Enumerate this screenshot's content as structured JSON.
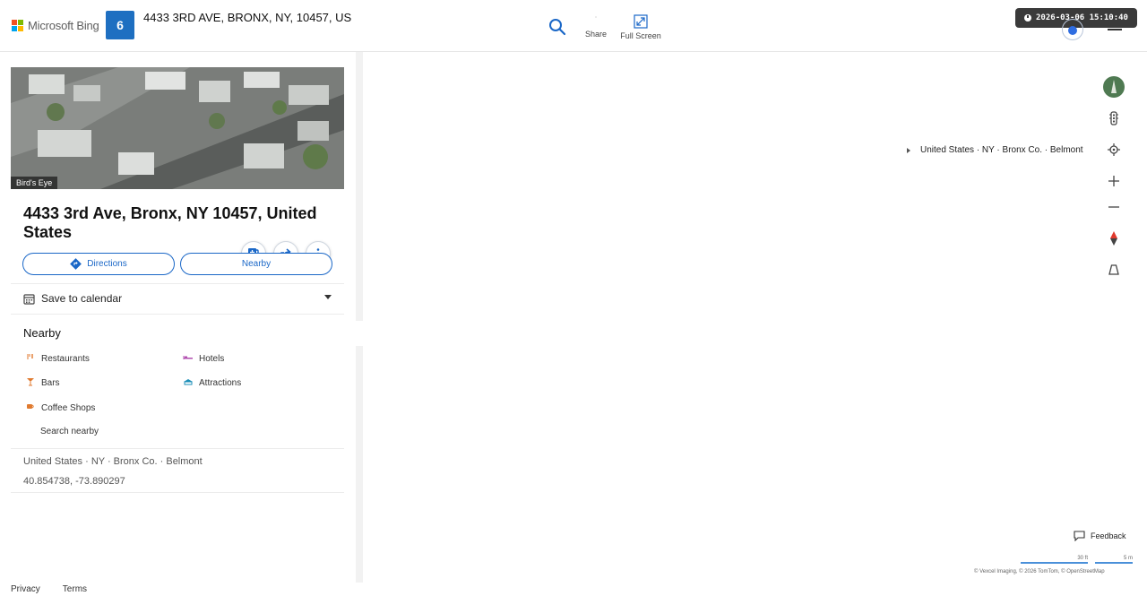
{
  "header": {
    "logo_text": "Microsoft Bing",
    "brand_colors": [
      "#f25022",
      "#7fba00",
      "#00a4ef",
      "#ffb900"
    ],
    "badge": "6",
    "search_query": "4433 3RD AVE, BRONX, NY, 10457, US",
    "share_label": "Share",
    "fullscreen_label": "Full Screen",
    "timestamp": "2026-03-06 15:10:40"
  },
  "card": {
    "image_label": "Bird's Eye",
    "title": "4433 3rd Ave, Bronx, NY 10457, United States",
    "directions_label": "Directions",
    "nearby_label": "Nearby",
    "calendar_label": "Save to calendar"
  },
  "nearby": {
    "title": "Nearby",
    "categories": [
      {
        "label": "Restaurants",
        "icon": "fork-knife-icon",
        "color": "#e07a2f"
      },
      {
        "label": "Hotels",
        "icon": "bed-icon",
        "color": "#b24fb0"
      },
      {
        "label": "Bars",
        "icon": "cocktail-icon",
        "color": "#e07a2f"
      },
      {
        "label": "Attractions",
        "icon": "landmark-icon",
        "color": "#1c8fb8"
      },
      {
        "label": "Coffee Shops",
        "icon": "coffee-icon",
        "color": "#e07a2f"
      }
    ],
    "search_label": "Search nearby"
  },
  "location": {
    "breadcrumb": "United States · NY · Bronx Co. · Belmont",
    "coordinates": "40.854738, -73.890297"
  },
  "map": {
    "breadcrumb": "United States · NY · Bronx Co. · Belmont",
    "feedback_label": "Feedback",
    "scale_ft": "30 ft",
    "scale_m": "5 m",
    "copyright": "© Vexcel Imaging, © 2026 TomTom, © OpenStreetMap",
    "accent_color": "#1a67c7"
  },
  "footer": {
    "privacy": "Privacy",
    "terms": "Terms"
  }
}
